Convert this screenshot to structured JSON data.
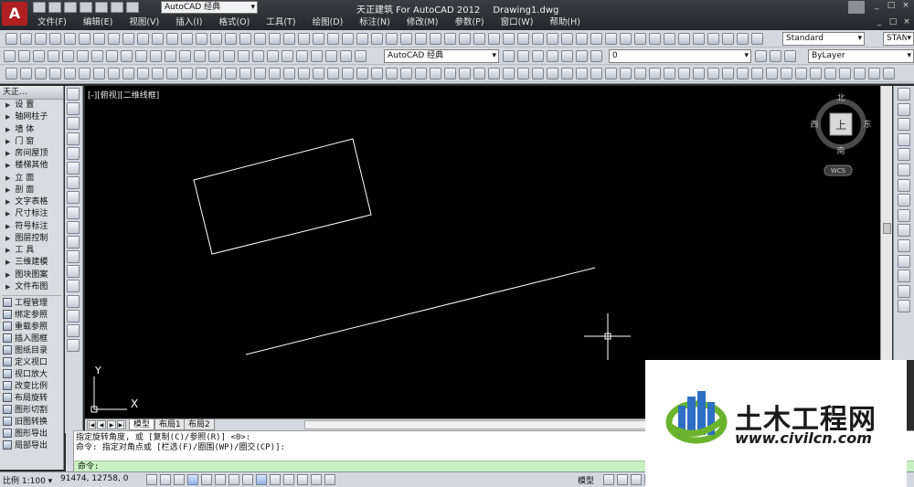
{
  "titlebar": {
    "logo": "A",
    "workspace": "AutoCAD 经典",
    "app_title": "天正建筑 For AutoCAD 2012",
    "document": "Drawing1.dwg",
    "window_buttons": [
      "_",
      "□",
      "×"
    ],
    "mdi_buttons": [
      "_",
      "□",
      "×"
    ]
  },
  "menu": [
    "文件(F)",
    "编辑(E)",
    "视图(V)",
    "插入(I)",
    "格式(O)",
    "工具(T)",
    "绘图(D)",
    "标注(N)",
    "修改(M)",
    "参数(P)",
    "窗口(W)",
    "帮助(H)"
  ],
  "toolbar": {
    "text_style": "Standard",
    "style_right": "STAN",
    "workspace2": "AutoCAD 经典",
    "layer": "0",
    "bylayer": "ByLayer"
  },
  "tarch_panel": {
    "title": "天正...",
    "items": [
      "设 置",
      "轴网柱子",
      "墙 体",
      "门 窗",
      "房间屋顶",
      "楼梯其他",
      "立 面",
      "剖 面",
      "文字表格",
      "尺寸标注",
      "符号标注",
      "图层控制",
      "工 具",
      "三维建模",
      "图块图案",
      "文件布图"
    ],
    "commands": [
      "工程管理",
      "绑定参照",
      "重载参照",
      "插入图框",
      "图纸目录",
      "定义视口",
      "视口放大",
      "改变比例",
      "布局旋转",
      "图形切割",
      "旧图转换",
      "图形导出",
      "局部导出"
    ]
  },
  "viewport": {
    "label": "[-][俯视][二维线框]",
    "compass": {
      "north": "北",
      "south": "南",
      "east": "东",
      "west": "西",
      "top": "上",
      "ucs": "WCS"
    },
    "ucs_x": "X",
    "ucs_y": "Y"
  },
  "tabs": {
    "nav": [
      "|◀",
      "◀",
      "▶",
      "▶|"
    ],
    "items": [
      "模型",
      "布局1",
      "布局2"
    ],
    "active": "模型"
  },
  "command": {
    "history_1": "指定旋转角度, 或 [复制(C)/参照(R)] <0>:",
    "history_2": "命令: 指定对角点或 [栏选(F)/圈围(WP)/圈交(CP)]:",
    "prompt": "命令:"
  },
  "status": {
    "scale": "比例 1:100 ▾",
    "coords": "91474, 12758, 0",
    "model": "模型"
  },
  "watermark": {
    "title": "土木工程网",
    "url": "www.civilcn.com"
  },
  "colors": {
    "canvas": "#000000",
    "geometry": "#ffffff",
    "command_line": "#c8f0c0",
    "logo_red": "#b02020",
    "watermark_blue": "#2d6fc4",
    "watermark_green": "#6ab42d"
  }
}
